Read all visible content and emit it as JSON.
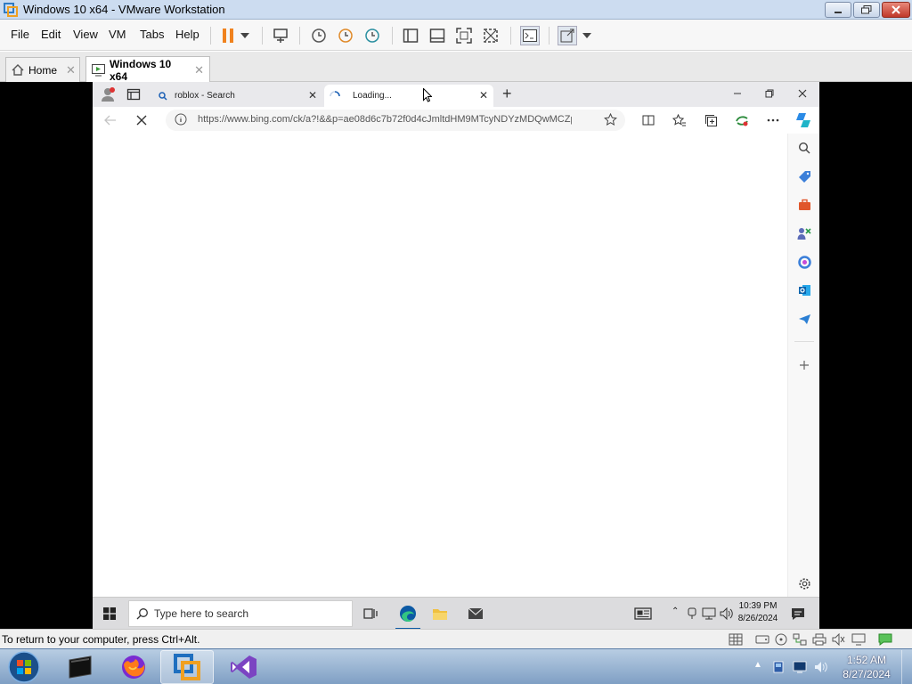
{
  "vmware": {
    "title": "Windows 10 x64 - VMware Workstation",
    "menu": [
      "File",
      "Edit",
      "View",
      "VM",
      "Tabs",
      "Help"
    ],
    "tabs": [
      {
        "label": "Home",
        "active": false
      },
      {
        "label": "Windows 10 x64",
        "active": true
      }
    ],
    "status_message": "To return to your computer, press Ctrl+Alt."
  },
  "edge": {
    "tabs": [
      {
        "label": "roblox - Search",
        "icon": "search-icon",
        "active": false
      },
      {
        "label": "Loading...",
        "icon": "loading-spinner-icon",
        "active": true
      }
    ],
    "new_tab": "+",
    "url": "https://www.bing.com/ck/a?!&&p=ae08d6c7b72f0d4cJmltdHM9MTcyNDYzMDQwMCZp...",
    "sidebar_icons": [
      "search-icon",
      "shopping-tag-icon",
      "tools-icon",
      "games-icon",
      "copilot-icon",
      "outlook-icon",
      "send-icon",
      "add-icon",
      "settings-icon"
    ]
  },
  "guest_taskbar": {
    "search_placeholder": "Type here to search",
    "time": "10:39 PM",
    "date": "8/26/2024"
  },
  "host_taskbar": {
    "time": "1:52 AM",
    "date": "8/27/2024"
  },
  "colors": {
    "vm_title_bg": "#ccdcf0",
    "pause_orange": "#f0821e",
    "edge_blue": "#0c59a4",
    "host_taskbar": "#8fadcf"
  }
}
